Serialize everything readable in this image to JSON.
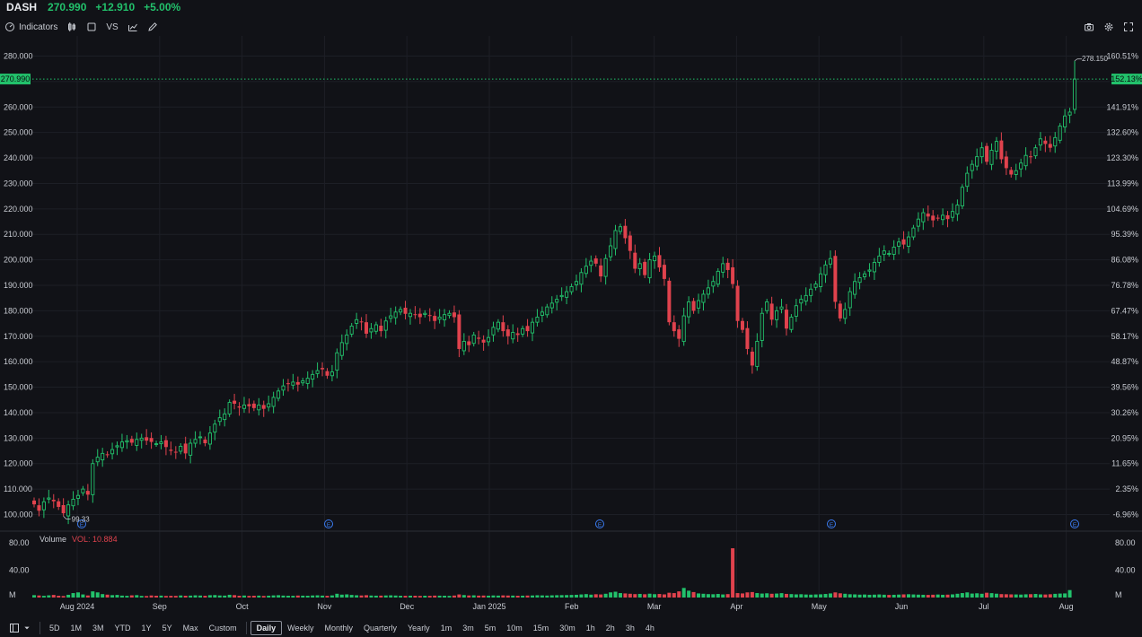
{
  "quote": {
    "symbol": "DASH",
    "price": "270.990",
    "change": "+12.910",
    "percent": "+5.00%"
  },
  "toolbar": {
    "indicators_label": "Indicators",
    "vs_label": "VS",
    "left_icons": [
      "indicators-icon",
      "candle-type-icon",
      "square-icon",
      "vs-compare",
      "draw-chart-icon",
      "pencil-icon"
    ],
    "right_icons": [
      "camera-icon",
      "gear-icon",
      "expand-icon"
    ]
  },
  "price_tag": {
    "label": "270.990",
    "percent_label": "152.13%",
    "color": "#22c16b"
  },
  "high_label": "278.150",
  "low_label": "99.33",
  "earnings_marker": "E",
  "volume": {
    "label": "Volume",
    "value_label": "VOL: 10.884",
    "axis_labels": [
      "80.00",
      "40.00",
      "M"
    ]
  },
  "bottom": {
    "ranges": [
      "5D",
      "1M",
      "3M",
      "YTD",
      "1Y",
      "5Y",
      "Max",
      "Custom"
    ],
    "intervals": [
      "Daily",
      "Weekly",
      "Monthly",
      "Quarterly",
      "Yearly",
      "1m",
      "3m",
      "5m",
      "10m",
      "15m",
      "30m",
      "1h",
      "2h",
      "3h",
      "4h"
    ],
    "active_interval": "Daily"
  },
  "colors": {
    "up": "#22c16b",
    "down": "#e0424d",
    "background": "#111217",
    "grid": "#1d1f26",
    "text": "#c9ccd3",
    "earnings": "#3b7cf2"
  },
  "chart_data": {
    "type": "candlestick",
    "x_tick_labels": [
      "Aug 2024",
      "Sep",
      "Oct",
      "Nov",
      "Dec",
      "Jan 2025",
      "Feb",
      "Mar",
      "Apr",
      "May",
      "Jun",
      "Jul",
      "Aug"
    ],
    "y_left_ticks": [
      "100.000",
      "110.000",
      "120.000",
      "130.000",
      "140.000",
      "150.000",
      "160.000",
      "170.000",
      "180.000",
      "190.000",
      "200.000",
      "210.000",
      "220.000",
      "230.000",
      "240.000",
      "250.000",
      "260.000",
      "270.000",
      "280.000"
    ],
    "y_right_ticks": [
      "-6.96%",
      "2.35%",
      "11.65%",
      "20.95%",
      "30.26%",
      "39.56%",
      "48.87%",
      "58.17%",
      "67.47%",
      "76.78%",
      "86.08%",
      "95.39%",
      "104.69%",
      "113.99%",
      "123.30%",
      "132.60%",
      "141.91%",
      "152.13%",
      "160.51%"
    ],
    "ylim": [
      100,
      280
    ],
    "last_close": 270.99,
    "high": 278.15,
    "low": 99.33,
    "earnings_markers": [
      "Aug 2024",
      "Nov",
      "Feb",
      "May",
      "Aug"
    ],
    "closes": [
      104.0,
      101.5,
      105.0,
      106.5,
      105.2,
      103.0,
      100.5,
      103.8,
      106.0,
      107.5,
      110.0,
      107.8,
      120.0,
      122.5,
      124.0,
      123.5,
      125.5,
      127.0,
      128.5,
      129.0,
      128.2,
      129.5,
      130.0,
      129.0,
      128.5,
      127.8,
      128.5,
      126.5,
      125.0,
      124.5,
      126.8,
      124.0,
      128.0,
      129.5,
      130.5,
      128.0,
      132.0,
      135.5,
      138.0,
      139.5,
      144.0,
      143.5,
      142.0,
      143.0,
      142.5,
      141.8,
      143.0,
      141.5,
      143.5,
      146.0,
      148.5,
      150.5,
      151.5,
      152.0,
      151.0,
      152.5,
      153.5,
      155.0,
      156.5,
      157.0,
      154.5,
      156.0,
      163.5,
      167.5,
      170.5,
      174.0,
      176.5,
      175.5,
      171.0,
      173.0,
      174.5,
      172.0,
      176.0,
      178.0,
      179.5,
      180.5,
      178.8,
      179.0,
      178.5,
      177.5,
      179.0,
      178.0,
      176.0,
      177.5,
      178.5,
      179.0,
      177.5,
      165.0,
      168.0,
      166.5,
      170.5,
      169.0,
      167.5,
      169.5,
      173.5,
      175.5,
      172.0,
      170.0,
      171.5,
      170.5,
      173.0,
      172.0,
      175.5,
      177.5,
      179.5,
      181.5,
      183.0,
      184.5,
      186.0,
      187.5,
      189.5,
      191.5,
      195.0,
      197.5,
      199.5,
      198.5,
      193.5,
      200.5,
      205.5,
      211.5,
      213.0,
      208.5,
      203.5,
      196.5,
      198.5,
      194.0,
      200.0,
      201.5,
      197.0,
      192.5,
      175.5,
      172.0,
      169.0,
      178.0,
      183.5,
      180.0,
      184.0,
      186.5,
      189.0,
      191.5,
      195.5,
      198.5,
      196.0,
      190.5,
      176.0,
      172.5,
      165.0,
      158.5,
      168.0,
      179.0,
      183.5,
      176.5,
      180.0,
      181.5,
      173.0,
      177.5,
      182.0,
      184.5,
      186.0,
      188.5,
      190.5,
      194.5,
      198.0,
      200.5,
      183.5,
      177.0,
      180.5,
      187.5,
      191.5,
      193.0,
      194.5,
      196.0,
      199.0,
      201.5,
      203.5,
      202.5,
      205.0,
      207.0,
      206.0,
      209.0,
      212.5,
      216.0,
      218.5,
      217.0,
      215.5,
      216.5,
      217.5,
      216.0,
      219.0,
      221.5,
      228.5,
      234.0,
      237.5,
      240.5,
      244.0,
      238.5,
      243.0,
      246.5,
      239.5,
      236.0,
      233.5,
      235.0,
      238.0,
      241.0,
      240.5,
      244.0,
      247.5,
      245.5,
      244.0,
      248.0,
      252.5,
      256.5,
      258.0,
      270.99
    ],
    "volumes": [
      3.5,
      3.0,
      2.5,
      3.2,
      3.8,
      2.6,
      2.2,
      4.0,
      6.5,
      7.5,
      4.5,
      3.0,
      9.0,
      7.5,
      5.0,
      4.2,
      3.5,
      3.8,
      2.8,
      2.5,
      3.2,
      3.5,
      2.4,
      2.2,
      3.0,
      2.6,
      2.8,
      2.3,
      2.5,
      2.4,
      3.0,
      2.6,
      2.8,
      3.2,
      2.9,
      2.5,
      3.4,
      3.6,
      3.0,
      2.8,
      4.0,
      3.5,
      2.6,
      2.9,
      2.4,
      2.6,
      2.8,
      2.3,
      2.7,
      3.1,
      3.4,
      2.8,
      2.6,
      2.5,
      2.9,
      2.7,
      2.6,
      3.0,
      3.2,
      2.8,
      2.5,
      3.1,
      5.5,
      4.2,
      4.6,
      3.8,
      3.3,
      3.0,
      3.4,
      2.9,
      2.7,
      2.8,
      3.0,
      3.2,
      2.9,
      2.6,
      2.5,
      2.7,
      2.6,
      2.4,
      2.6,
      2.5,
      2.8,
      2.7,
      2.6,
      2.4,
      2.9,
      4.5,
      3.6,
      3.0,
      3.2,
      2.8,
      2.9,
      2.7,
      3.0,
      2.8,
      3.1,
      2.9,
      2.8,
      2.6,
      2.7,
      2.9,
      3.0,
      3.3,
      3.1,
      2.9,
      3.2,
      3.4,
      3.5,
      3.6,
      3.8,
      4.0,
      4.5,
      5.0,
      4.2,
      4.8,
      4.5,
      5.5,
      7.5,
      8.5,
      6.5,
      6.0,
      5.5,
      5.0,
      5.3,
      4.8,
      5.6,
      4.9,
      5.2,
      4.6,
      7.0,
      6.5,
      9.0,
      14.0,
      10.0,
      8.0,
      6.0,
      5.5,
      5.0,
      4.8,
      5.2,
      4.5,
      5.0,
      72.0,
      6.5,
      6.0,
      7.5,
      8.0,
      6.5,
      5.8,
      6.2,
      5.5,
      5.8,
      6.4,
      5.3,
      5.0,
      4.6,
      4.8,
      4.4,
      4.2,
      4.5,
      4.7,
      5.2,
      6.0,
      7.5,
      6.2,
      5.5,
      4.8,
      4.6,
      4.2,
      4.4,
      4.0,
      4.2,
      4.5,
      4.1,
      3.8,
      4.0,
      4.3,
      4.6,
      4.8,
      4.5,
      4.2,
      4.0,
      3.8,
      4.1,
      4.4,
      4.0,
      4.2,
      4.6,
      5.5,
      6.5,
      7.5,
      5.8,
      6.2,
      5.5,
      7.0,
      6.4,
      5.6,
      5.0,
      4.8,
      4.6,
      4.5,
      4.3,
      4.7,
      4.9,
      5.2,
      4.6,
      4.4,
      4.8,
      5.4,
      5.8,
      6.0,
      10.884
    ]
  }
}
